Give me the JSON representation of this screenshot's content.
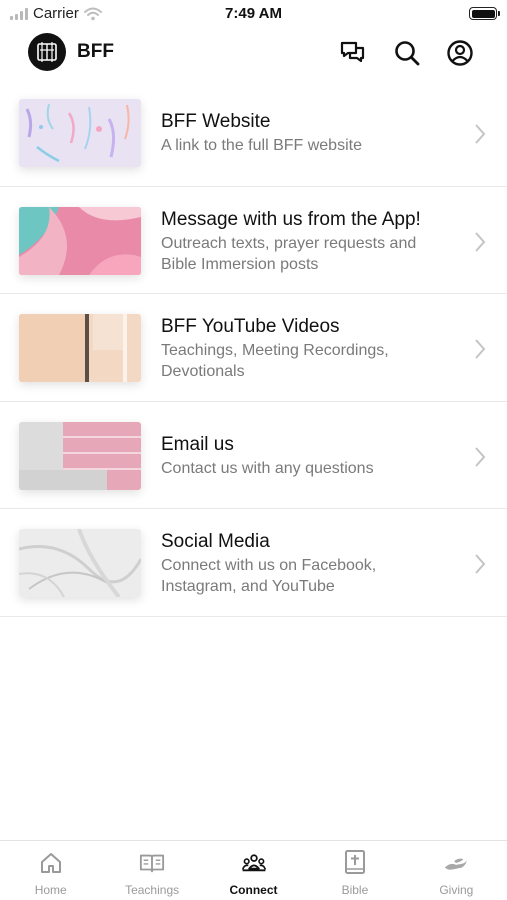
{
  "status_bar": {
    "carrier": "Carrier",
    "time": "7:49 AM"
  },
  "header": {
    "app_name": "BFF"
  },
  "list": [
    {
      "title": "BFF Website",
      "subtitle": "A link to the full BFF website"
    },
    {
      "title": "Message with us from the App!",
      "subtitle": "Outreach texts, prayer requests and Bible Immersion posts"
    },
    {
      "title": "BFF YouTube Videos",
      "subtitle": "Teachings, Meeting Recordings, Devotionals"
    },
    {
      "title": "Email us",
      "subtitle": "Contact us with any questions"
    },
    {
      "title": "Social Media",
      "subtitle": "Connect with us on Facebook, Instagram, and YouTube"
    }
  ],
  "tabs": [
    {
      "label": "Home",
      "icon": "home-icon"
    },
    {
      "label": "Teachings",
      "icon": "book-open-icon"
    },
    {
      "label": "Connect",
      "icon": "people-icon",
      "active": true
    },
    {
      "label": "Bible",
      "icon": "bible-icon"
    },
    {
      "label": "Giving",
      "icon": "giving-hand-icon"
    }
  ],
  "colors": {
    "active_tab": "#111111",
    "inactive_tab": "#9a9a9a",
    "subtitle": "#7a7a7a",
    "divider": "#e8e8e8"
  }
}
